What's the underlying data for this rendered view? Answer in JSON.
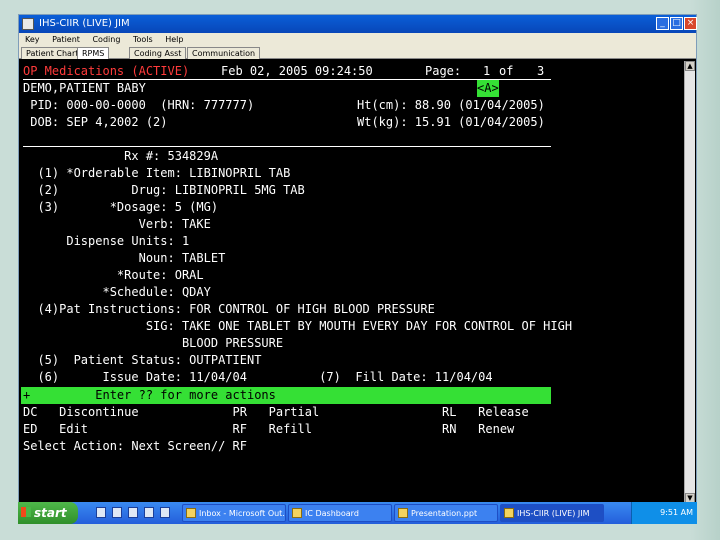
{
  "window": {
    "title": "IHS-CIIR (LIVE) JIM",
    "controls": [
      "_",
      "□",
      "×"
    ]
  },
  "menu": [
    "Key",
    "Patient",
    "Coding",
    "Tools",
    "Help"
  ],
  "tabs": [
    "Patient Chart",
    "RPMS",
    "Coding Asst",
    "Communication"
  ],
  "terminal": {
    "header_left": "OP Medications (ACTIVE)",
    "header_date": "Feb 02, 2005 09:24:50",
    "page_label": "Page:",
    "page_num": "1",
    "page_of": "of",
    "page_total": "3",
    "patient_name": "DEMO,PATIENT BABY",
    "code_a": "<A>",
    "pid_line": " PID: 000-00-0000  (HRN: 777777)",
    "ht_line": "Ht(cm): 88.90 (01/04/2005)",
    "dob_line": " DOB: SEP 4,2002 (2)",
    "wt_line": "Wt(kg): 15.91 (01/04/2005)",
    "rows": [
      "              Rx #: 534829A",
      "  (1) *Orderable Item: LIBINOPRIL TAB",
      "  (2)          Drug: LIBINOPRIL 5MG TAB",
      "  (3)       *Dosage: 5 (MG)",
      "                Verb: TAKE",
      "      Dispense Units: 1",
      "                Noun: TABLET",
      "             *Route: ORAL",
      "           *Schedule: QDAY",
      "  (4)Pat Instructions: FOR CONTROL OF HIGH BLOOD PRESSURE",
      "                 SIG: TAKE ONE TABLET BY MOUTH EVERY DAY FOR CONTROL OF HIGH",
      "                      BLOOD PRESSURE",
      "  (5)  Patient Status: OUTPATIENT",
      "  (6)      Issue Date: 11/04/04          (7)  Fill Date: 11/04/04"
    ],
    "action_bar": "+         Enter ?? for more actions",
    "actions": [
      "DC   Discontinue             PR   Partial                 RL   Release",
      "ED   Edit                    RF   Refill                  RN   Renew"
    ],
    "prompt": "Select Action: Next Screen// RF"
  },
  "taskbar": {
    "start_label": "start",
    "tasks": [
      "Inbox - Microsoft Out...",
      "IC Dashboard",
      "Presentation.ppt",
      "IHS-CIIR (LIVE) JIM"
    ],
    "clock": "9:51 AM"
  }
}
